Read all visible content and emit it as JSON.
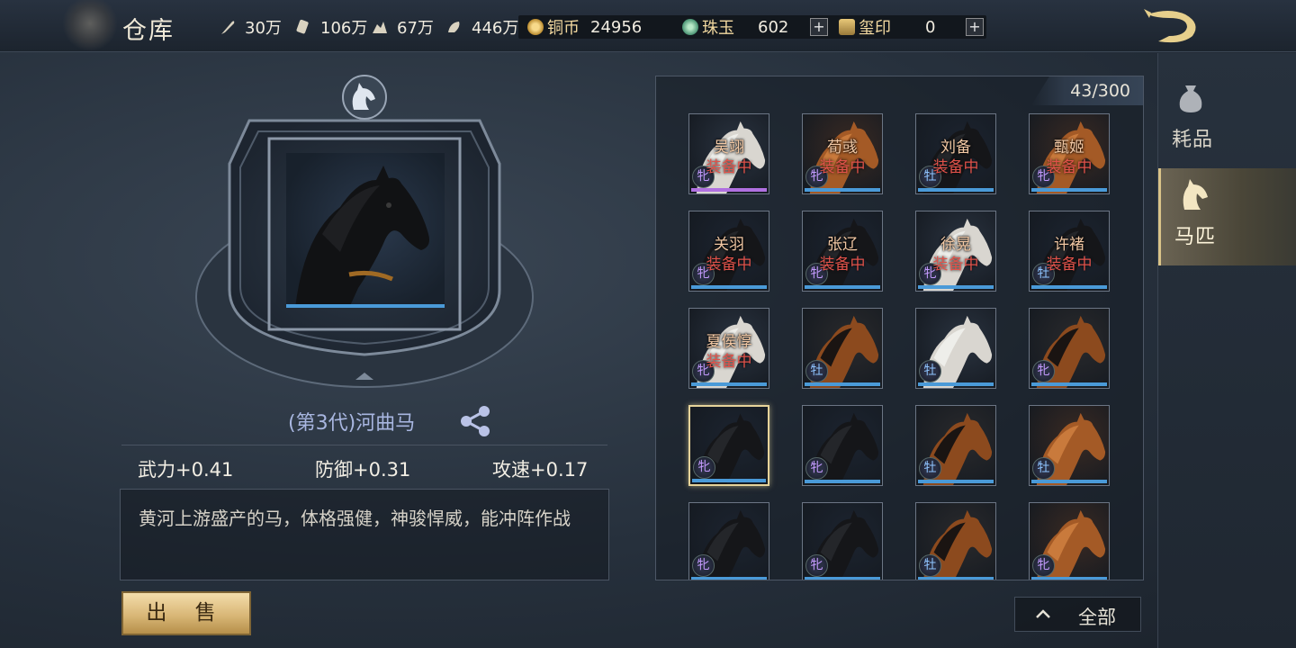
{
  "header": {
    "title": "仓库",
    "resources": [
      {
        "icon": "feather-icon",
        "value": "30万"
      },
      {
        "icon": "scroll-icon",
        "value": "106万"
      },
      {
        "icon": "ore-icon",
        "value": "67万"
      },
      {
        "icon": "grain-icon",
        "value": "446万"
      }
    ],
    "currencies": {
      "coin": {
        "name": "铜币",
        "value": "24956"
      },
      "jade": {
        "name": "珠玉",
        "value": "602"
      },
      "seal": {
        "name": "玺印",
        "value": "0"
      }
    },
    "plus_label": "+"
  },
  "sidebar": {
    "tabs": [
      {
        "label": "耗品",
        "icon": "pouch-icon"
      },
      {
        "label": "马匹",
        "icon": "horse-head-icon"
      }
    ]
  },
  "detail": {
    "name": "(第3代)河曲马",
    "stats": [
      "武力+0.41",
      "防御+0.31",
      "攻速+0.17"
    ],
    "description": "黄河上游盛产的马，体格强健，神骏悍威，能冲阵作战",
    "sell_label": "出 售"
  },
  "inventory": {
    "count": "43/300",
    "filter_label": "全部",
    "equipped_label": "装备中",
    "items": [
      {
        "owner": "吴翊",
        "equipped": true,
        "gender": "牝",
        "coat": "white",
        "bar": "purple"
      },
      {
        "owner": "荀彧",
        "equipped": true,
        "gender": "牝",
        "coat": "chestnut",
        "bar": "blue"
      },
      {
        "owner": "刘备",
        "equipped": true,
        "gender": "牡",
        "coat": "black",
        "bar": "blue"
      },
      {
        "owner": "甄姬",
        "equipped": true,
        "gender": "牝",
        "coat": "chestnut",
        "bar": "blue"
      },
      {
        "owner": "关羽",
        "equipped": true,
        "gender": "牝",
        "coat": "black",
        "bar": "blue"
      },
      {
        "owner": "张辽",
        "equipped": true,
        "gender": "牝",
        "coat": "black",
        "bar": "blue"
      },
      {
        "owner": "徐晃",
        "equipped": true,
        "gender": "牝",
        "coat": "white",
        "bar": "blue"
      },
      {
        "owner": "许褚",
        "equipped": true,
        "gender": "牡",
        "coat": "black",
        "bar": "blue"
      },
      {
        "owner": "夏侯惇",
        "equipped": true,
        "gender": "牝",
        "coat": "white",
        "bar": "blue"
      },
      {
        "owner": "",
        "equipped": false,
        "gender": "牡",
        "coat": "bay",
        "bar": "blue"
      },
      {
        "owner": "",
        "equipped": false,
        "gender": "牡",
        "coat": "white",
        "bar": "blue"
      },
      {
        "owner": "",
        "equipped": false,
        "gender": "牝",
        "coat": "bay",
        "bar": "blue"
      },
      {
        "owner": "",
        "equipped": false,
        "gender": "牝",
        "coat": "black",
        "bar": "blue",
        "selected": true
      },
      {
        "owner": "",
        "equipped": false,
        "gender": "牝",
        "coat": "black",
        "bar": "blue"
      },
      {
        "owner": "",
        "equipped": false,
        "gender": "牡",
        "coat": "bay",
        "bar": "blue"
      },
      {
        "owner": "",
        "equipped": false,
        "gender": "牡",
        "coat": "chestnut",
        "bar": "blue"
      },
      {
        "owner": "",
        "equipped": false,
        "gender": "牝",
        "coat": "black",
        "bar": "blue"
      },
      {
        "owner": "",
        "equipped": false,
        "gender": "牝",
        "coat": "black",
        "bar": "blue"
      },
      {
        "owner": "",
        "equipped": false,
        "gender": "牡",
        "coat": "bay",
        "bar": "blue"
      },
      {
        "owner": "",
        "equipped": false,
        "gender": "牝",
        "coat": "chestnut",
        "bar": "blue"
      }
    ]
  },
  "colors": {
    "female_tag": "#c59bff",
    "male_tag": "#8fc4ff",
    "equipped_text": "#e0524a",
    "bar_blue": "#4a9ad8",
    "bar_purple": "#b070e0",
    "accent_gold": "#d9c388"
  }
}
